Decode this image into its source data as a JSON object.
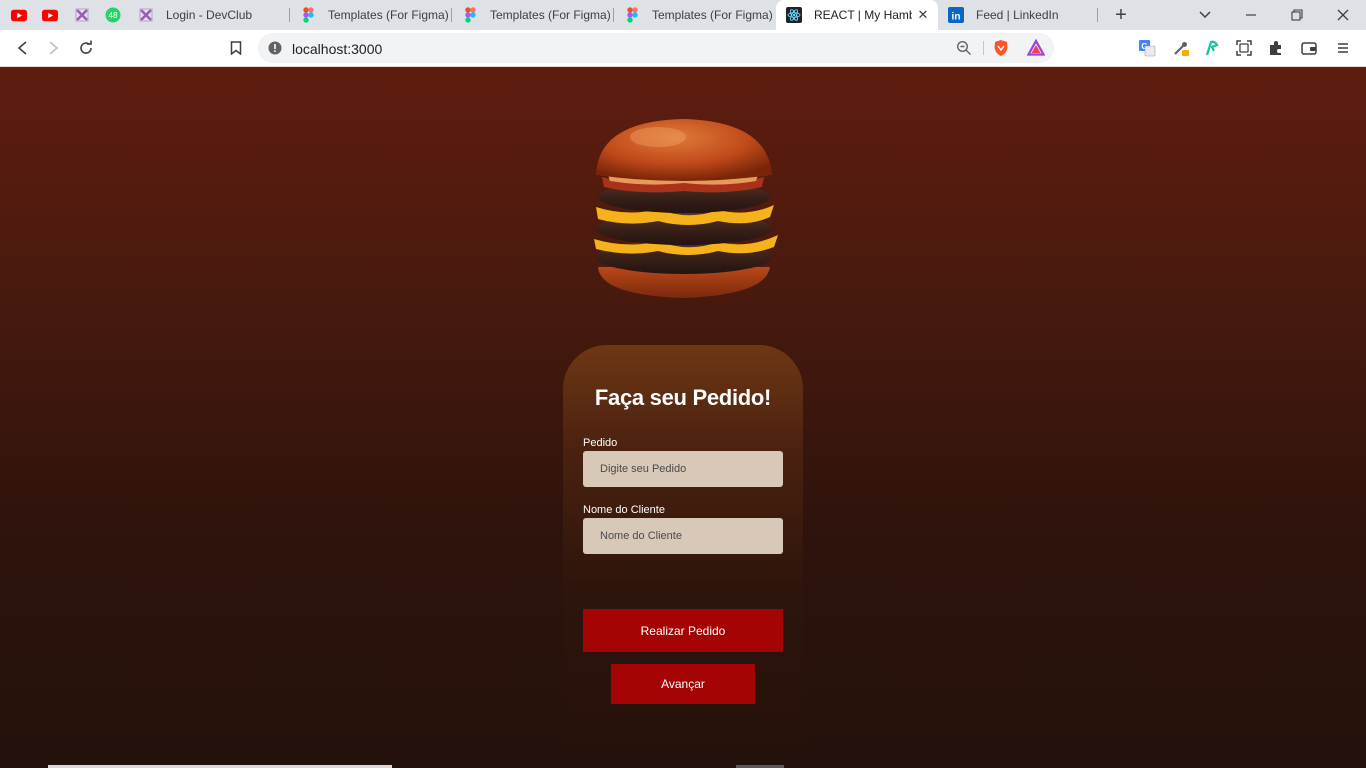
{
  "browser": {
    "pinned_tabs": [
      {
        "icon": "youtube-icon"
      },
      {
        "icon": "youtube-icon"
      },
      {
        "icon": "devclub-icon"
      },
      {
        "icon": "whatsapp-icon",
        "badge": "48"
      }
    ],
    "tabs": [
      {
        "title": "Login - DevClub",
        "icon": "devclub-icon"
      },
      {
        "title": "Templates (For Figma) -",
        "icon": "figma-icon"
      },
      {
        "title": "Templates (For Figma) -",
        "icon": "figma-icon"
      },
      {
        "title": "Templates (For Figma) -",
        "icon": "figma-icon"
      },
      {
        "title": "REACT | My Hamburguer",
        "icon": "react-icon",
        "active": true
      },
      {
        "title": "Feed | LinkedIn",
        "icon": "linkedin-icon"
      }
    ],
    "url": "localhost:3000",
    "colors": {
      "tab_bar": "#dee1e6",
      "toolbar": "#ffffff",
      "omnibox": "#f1f3f4"
    }
  },
  "page": {
    "title": "Faça seu Pedido!",
    "fields": [
      {
        "label": "Pedido",
        "placeholder": "Digite seu Pedido",
        "value": ""
      },
      {
        "label": "Nome do Cliente",
        "placeholder": "Nome do Cliente",
        "value": ""
      }
    ],
    "submit_label": "Realizar Pedido",
    "next_label": "Avançar",
    "colors": {
      "background_top": "#5f1c0f",
      "background_bottom": "#24110b",
      "card_top": "#6e3714",
      "input_bg": "#d8c8b8",
      "button": "#a50404"
    }
  }
}
